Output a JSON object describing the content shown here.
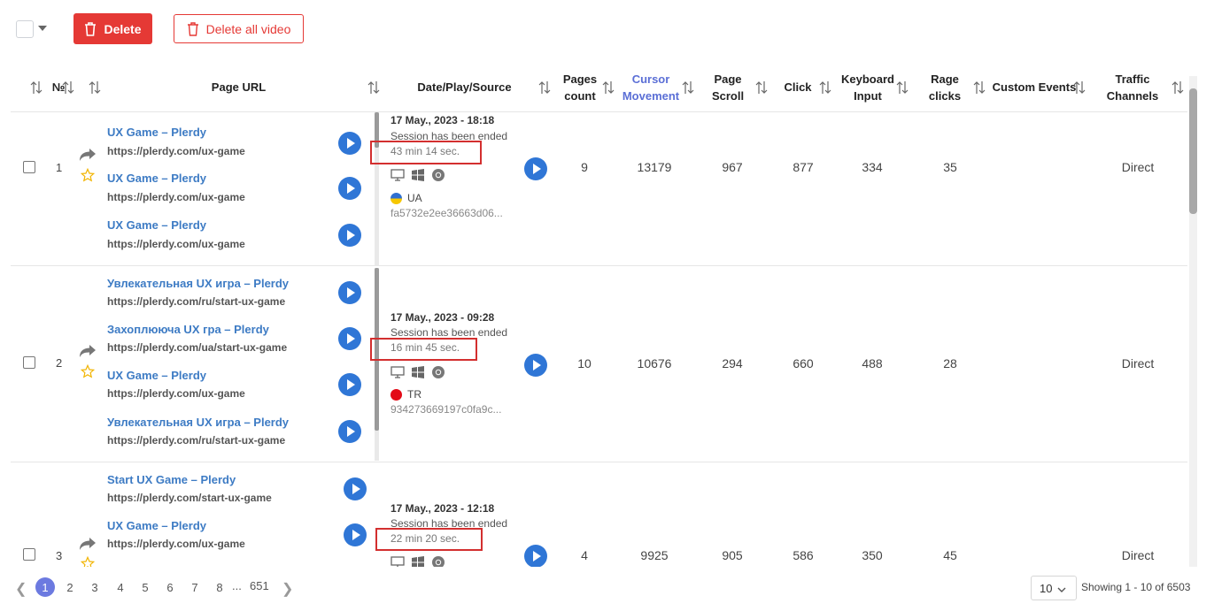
{
  "toolbar": {
    "delete_label": "Delete",
    "delete_all_label": "Delete all video"
  },
  "colors": {
    "accent": "#2f76d6",
    "danger": "#e53935",
    "link": "#3d7bc4",
    "highlight_box": "#d32f2f",
    "active_page": "#6c7ae0"
  },
  "columns": {
    "num": "№",
    "page_url": "Page URL",
    "date_play_source": "Date/Play/Source",
    "pages_count_1": "Pages",
    "pages_count_2": "count",
    "cursor_1": "Cursor",
    "cursor_2": "Movement",
    "scroll_1": "Page",
    "scroll_2": "Scroll",
    "click": "Click",
    "keyboard_1": "Keyboard",
    "keyboard_2": "Input",
    "rage_1": "Rage",
    "rage_2": "clicks",
    "custom_events": "Custom Events",
    "traffic_1": "Traffic",
    "traffic_2": "Channels"
  },
  "rows": [
    {
      "num": "1",
      "pages": [
        {
          "title": "UX Game – Plerdy",
          "url": "https://plerdy.com/ux-game"
        },
        {
          "title": "UX Game – Plerdy",
          "url": "https://plerdy.com/ux-game"
        },
        {
          "title": "UX Game – Plerdy",
          "url": "https://plerdy.com/ux-game"
        }
      ],
      "date": "17 May., 2023 - 18:18",
      "status": "Session has been ended",
      "duration": "43 min 14 sec.",
      "country": "UA",
      "session_id": "fa5732e2ee36663d06...",
      "pages_count": "9",
      "cursor_movement": "13179",
      "page_scroll": "967",
      "click": "877",
      "keyboard_input": "334",
      "rage_clicks": "35",
      "traffic": "Direct"
    },
    {
      "num": "2",
      "pages": [
        {
          "title": "Увлекательная UX игра – Plerdy",
          "url": "https://plerdy.com/ru/start-ux-game"
        },
        {
          "title": "Захоплююча UX гра – Plerdy",
          "url": "https://plerdy.com/ua/start-ux-game"
        },
        {
          "title": "UX Game – Plerdy",
          "url": "https://plerdy.com/ux-game"
        },
        {
          "title": "Увлекательная UX игра – Plerdy",
          "url": "https://plerdy.com/ru/start-ux-game"
        }
      ],
      "date": "17 May., 2023 - 09:28",
      "status": "Session has been ended",
      "duration": "16 min 45 sec.",
      "country": "TR",
      "session_id": "934273669197c0fa9c...",
      "pages_count": "10",
      "cursor_movement": "10676",
      "page_scroll": "294",
      "click": "660",
      "keyboard_input": "488",
      "rage_clicks": "28",
      "traffic": "Direct"
    },
    {
      "num": "3",
      "pages": [
        {
          "title": "Start UX Game – Plerdy",
          "url": "https://plerdy.com/start-ux-game"
        },
        {
          "title": "UX Game – Plerdy",
          "url": "https://plerdy.com/ux-game"
        }
      ],
      "date": "17 May., 2023 - 12:18",
      "status": "Session has been ended",
      "duration": "22 min 20 sec.",
      "pages_count": "4",
      "cursor_movement": "9925",
      "page_scroll": "905",
      "click": "586",
      "keyboard_input": "350",
      "rage_clicks": "45",
      "traffic": "Direct"
    }
  ],
  "pagination": {
    "pages": [
      "1",
      "2",
      "3",
      "4",
      "5",
      "6",
      "7",
      "8"
    ],
    "dots": "...",
    "last": "651",
    "current": "1",
    "per_page": "10",
    "showing": "Showing 1 - 10 of 6503"
  },
  "icons": [
    "trash-icon",
    "sort-icon",
    "share-icon",
    "star-icon",
    "play-icon",
    "desktop-icon",
    "windows-icon",
    "chrome-icon",
    "chevron-left-icon",
    "chevron-right-icon",
    "chevron-down-icon"
  ]
}
